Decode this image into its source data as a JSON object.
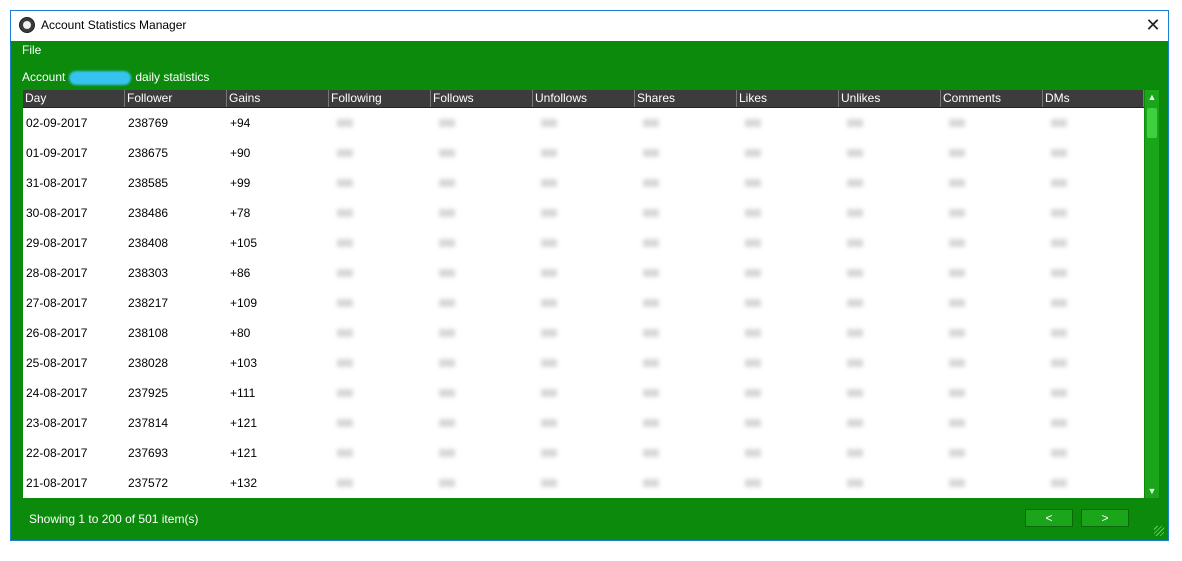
{
  "window": {
    "title": "Account Statistics Manager",
    "close_label": "✕"
  },
  "menu": {
    "file": "File"
  },
  "account": {
    "prefix": "Account",
    "suffix": "daily statistics"
  },
  "table": {
    "columns": [
      "Day",
      "Follower",
      "Gains",
      "Following",
      "Follows",
      "Unfollows",
      "Shares",
      "Likes",
      "Unlikes",
      "Comments",
      "DMs"
    ],
    "rows": [
      [
        "02-09-2017",
        "238769",
        "+94"
      ],
      [
        "01-09-2017",
        "238675",
        "+90"
      ],
      [
        "31-08-2017",
        "238585",
        "+99"
      ],
      [
        "30-08-2017",
        "238486",
        "+78"
      ],
      [
        "29-08-2017",
        "238408",
        "+105"
      ],
      [
        "28-08-2017",
        "238303",
        "+86"
      ],
      [
        "27-08-2017",
        "238217",
        "+109"
      ],
      [
        "26-08-2017",
        "238108",
        "+80"
      ],
      [
        "25-08-2017",
        "238028",
        "+103"
      ],
      [
        "24-08-2017",
        "237925",
        "+111"
      ],
      [
        "23-08-2017",
        "237814",
        "+121"
      ],
      [
        "22-08-2017",
        "237693",
        "+121"
      ],
      [
        "21-08-2017",
        "237572",
        "+132"
      ]
    ]
  },
  "status": {
    "text": "Showing 1 to 200 of 501 item(s)"
  },
  "pager": {
    "prev": "<",
    "next": ">"
  },
  "scroll": {
    "up": "▲",
    "down": "▼"
  },
  "colors": {
    "window_bg": "#0b8a0b",
    "header_bg": "#3c3c3c",
    "accent_blur": "#36c3f0"
  },
  "icons": {
    "app": "camera-lens-icon",
    "close": "close-icon"
  }
}
